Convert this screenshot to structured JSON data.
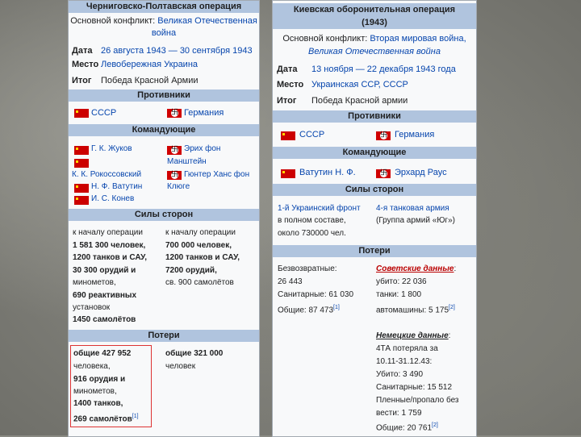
{
  "left": {
    "title": "Черниговско-Полтавская операция",
    "conflict_label": "Основной конфликт:",
    "conflict_value_line1": "Великая Отечественная",
    "conflict_value_line2": "война",
    "date_label": "Дата",
    "date_value": "26 августа 1943 — 30 сентября 1943",
    "place_label": "Место",
    "place_value": "Левобережная Украина",
    "result_label": "Итог",
    "result_value": "Победа Красной Армии",
    "opponents_header": "Противники",
    "side1": "СССР",
    "side2": "Германия",
    "commanders_header": "Командующие",
    "commanders_left": [
      "Г. К. Жуков",
      "",
      "К. К. Рокоссовский",
      "Н. Ф. Ватутин",
      "И. С. Конев"
    ],
    "commanders_right": [
      "Эрих фон",
      "Манштейн",
      "Гюнтер Ханс фон",
      "Клюге"
    ],
    "forces_header": "Силы сторон",
    "forces_left": [
      "к началу операции",
      "1 581 300 человек,",
      "1200 танков и САУ,",
      "30 300 орудий и",
      "минометов,",
      "690 реактивных",
      "установок",
      "1450 самолётов"
    ],
    "forces_right": [
      "к началу операции",
      "700 000 человек,",
      "1200 танков и САУ,",
      "7200 орудий,",
      "св. 900 самолётов"
    ],
    "losses_header": "Потери",
    "losses_left": [
      "общие 427 952",
      "человека,",
      "916 орудия и",
      "минометов,",
      "1400 танков,",
      "269 самолётов"
    ],
    "losses_left_ref": "[1]",
    "losses_right": [
      "общие 321 000",
      "человек"
    ]
  },
  "right": {
    "title_line1": "Киевская оборонительная операция",
    "title_line2": "(1943)",
    "conflict_label": "Основной конфликт:",
    "conflict_value_line1": "Вторая мировая война,",
    "conflict_value_line2": "Великая Отечественная война",
    "date_label": "Дата",
    "date_value": "13 ноября — 22 декабря 1943 года",
    "place_label": "Место",
    "place_value": "Украинская ССР, СССР",
    "result_label": "Итог",
    "result_value": "Победа Красной армии",
    "opponents_header": "Противники",
    "side1": "СССР",
    "side2": "Германия",
    "commanders_header": "Командующие",
    "commander1": "Ватутин Н. Ф.",
    "commander2": "Эрхард Раус",
    "forces_header": "Силы сторон",
    "forces_left": [
      "1-й Украинский фронт",
      "в полном составе,",
      "около 730000 чел."
    ],
    "forces_right": [
      "4-я танковая армия",
      "(Группа армий «Юг»)"
    ],
    "losses_header": "Потери",
    "losses_left": [
      "Безвозвратные:",
      "26 443",
      "Санитарные: 61 030",
      "Общие: 87 473"
    ],
    "losses_left_ref": "[1]",
    "soviet_label": "Советские данные",
    "soviet_lines": [
      "убито: 22 036",
      "танки: 1 800",
      "автомашины: 5 175"
    ],
    "soviet_ref": "[2]",
    "german_label": "Немецкие данные",
    "german_lines": [
      "4ТА потеряла за",
      "10.11-31.12.43:",
      "Убито: 3 490",
      "Санитарные: 15 512",
      "Пленные/пропало без",
      "вести: 1 759",
      "Общие: 20 761"
    ],
    "german_ref": "[2]"
  }
}
